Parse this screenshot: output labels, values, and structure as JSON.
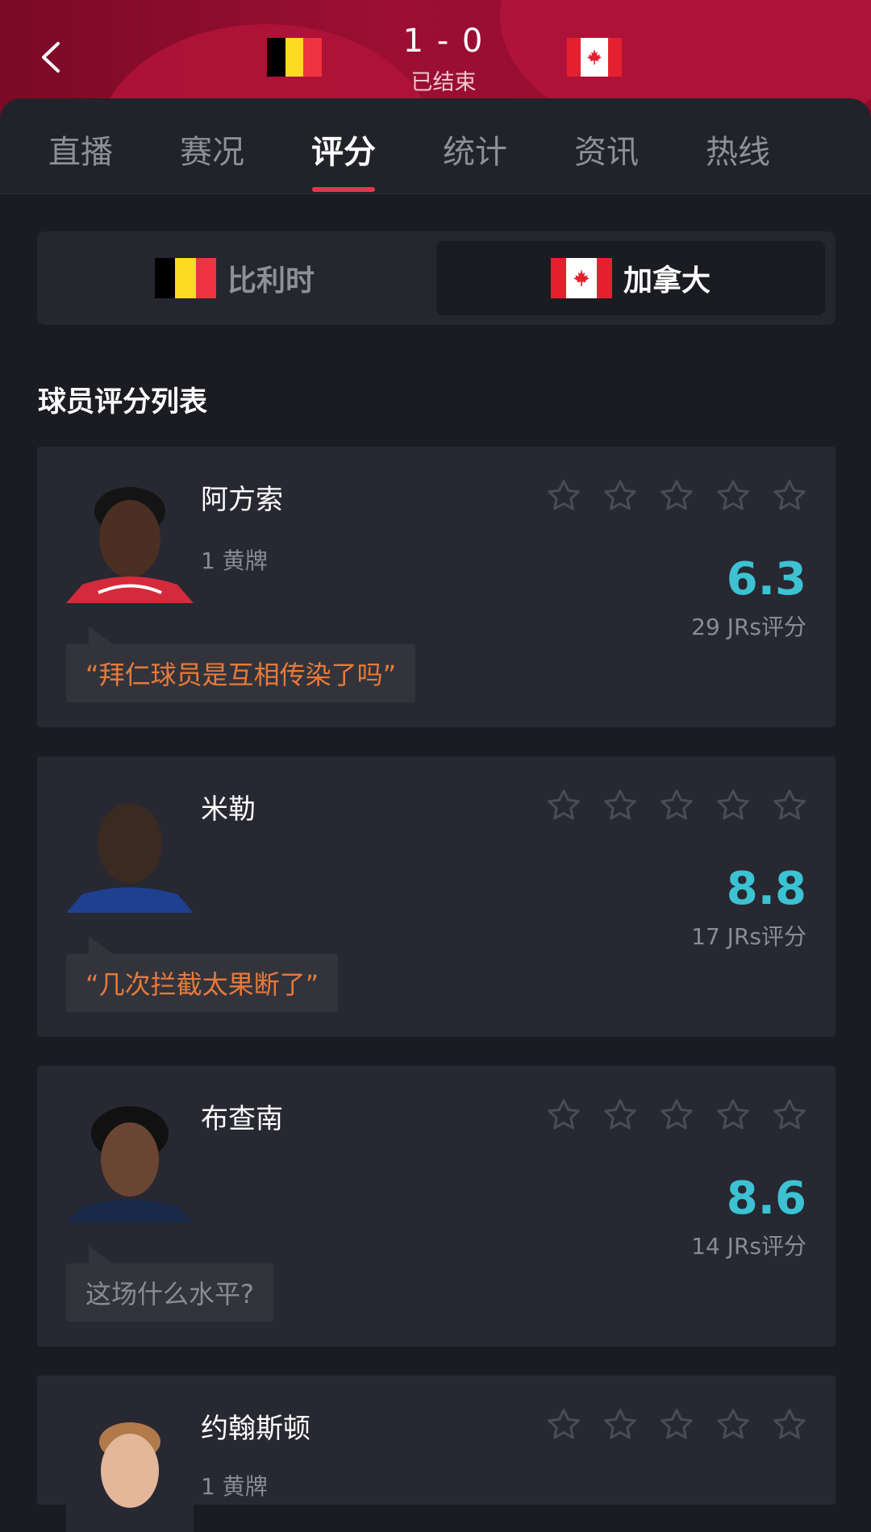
{
  "match": {
    "score": "1 - 0",
    "status": "已结束",
    "home_flag": "belgium-flag",
    "away_flag": "canada-flag"
  },
  "tabs": [
    {
      "label": "直播"
    },
    {
      "label": "赛况"
    },
    {
      "label": "评分",
      "active": true
    },
    {
      "label": "统计"
    },
    {
      "label": "资讯"
    },
    {
      "label": "热线"
    }
  ],
  "teams": [
    {
      "name": "比利时",
      "active": false
    },
    {
      "name": "加拿大",
      "active": true
    }
  ],
  "section_title": "球员评分列表",
  "players": [
    {
      "name": "阿方索",
      "sub": "1 黄牌",
      "rating": "6.3",
      "votes": "29 JRs评分",
      "comment": "“拜仁球员是互相传染了吗”",
      "comment_style": "orange",
      "stars": 5
    },
    {
      "name": "米勒",
      "sub": "",
      "rating": "8.8",
      "votes": "17 JRs评分",
      "comment": "“几次拦截太果断了”",
      "comment_style": "orange",
      "stars": 5
    },
    {
      "name": "布查南",
      "sub": "",
      "rating": "8.6",
      "votes": "14 JRs评分",
      "comment": "这场什么水平?",
      "comment_style": "grey",
      "stars": 5
    },
    {
      "name": "约翰斯顿",
      "sub": "1 黄牌",
      "rating": "",
      "votes": "",
      "comment": "",
      "comment_style": "",
      "stars": 5
    }
  ],
  "colors": {
    "accent": "#e0384f",
    "rating": "#3cc2d2",
    "comment_orange": "#e87a3a",
    "header_red": "#9c0f33"
  }
}
